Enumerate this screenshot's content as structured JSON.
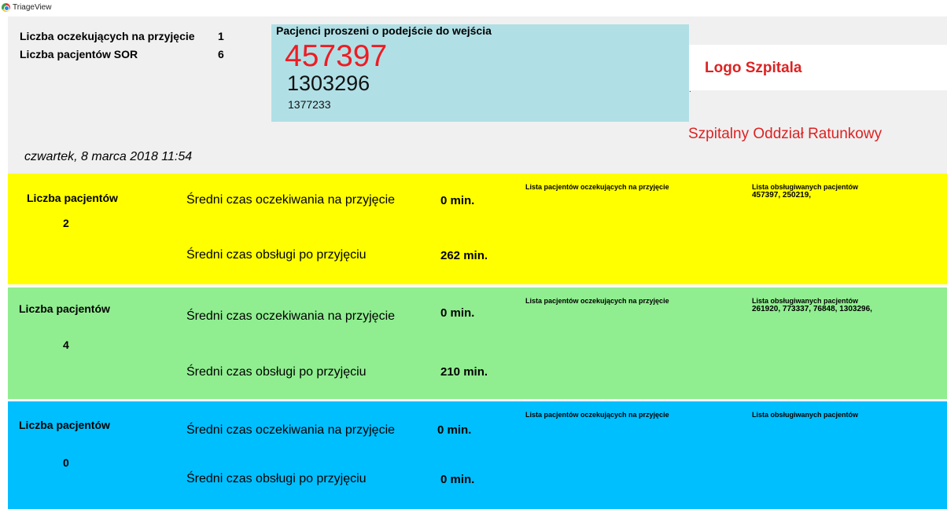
{
  "window": {
    "title": "TriageView"
  },
  "stats": {
    "waiting_label": "Liczba oczekujących na przyjęcie",
    "waiting_value": "1",
    "sor_label": "Liczba pacjentów SOR",
    "sor_value": "6"
  },
  "call_panel": {
    "heading": "Pacjenci proszeni o podejście do wejścia",
    "numbers": [
      "457397",
      "1303296",
      "1377233"
    ]
  },
  "logo": {
    "text": "Logo Szpitala",
    "dot": "."
  },
  "ward": {
    "name": "Szpitalny Oddział Ratunkowy"
  },
  "datetime": "czwartek, 8 marca 2018 11:54",
  "rows": [
    {
      "color": "#ffff00",
      "count_label": "Liczba pacjentów",
      "count": "2",
      "wait_label": "Średni czas oczekiwania na przyjęcie",
      "wait_value": "0 min.",
      "service_label": "Średni czas obsługi po przyjęciu",
      "service_value": "262 min.",
      "waiting_list_label": "Lista pacjentów oczekujących na przyjęcie",
      "waiting_list": "",
      "served_list_label": "Lista obsługiwanych pacjentów",
      "served_list": "457397, 250219,"
    },
    {
      "color": "#90ee90",
      "count_label": "Liczba pacjentów",
      "count": "4",
      "wait_label": "Średni czas oczekiwania na przyjęcie",
      "wait_value": "0 min.",
      "service_label": "Średni czas obsługi po przyjęciu",
      "service_value": "210 min.",
      "waiting_list_label": "Lista pacjentów oczekujących na przyjęcie",
      "waiting_list": "",
      "served_list_label": "Lista obsługiwanych pacjentów",
      "served_list": "261920, 773337, 76848, 1303296,"
    },
    {
      "color": "#00bfff",
      "count_label": "Liczba pacjentów",
      "count": "0",
      "wait_label": "Średni czas oczekiwania na przyjęcie",
      "wait_value": "0 min.",
      "service_label": "Średni czas obsługi po przyjęciu",
      "service_value": "0 min.",
      "waiting_list_label": "Lista pacjentów oczekujących na przyjęcie",
      "waiting_list": "",
      "served_list_label": "Lista obsługiwanych pacjentów",
      "served_list": ""
    }
  ]
}
